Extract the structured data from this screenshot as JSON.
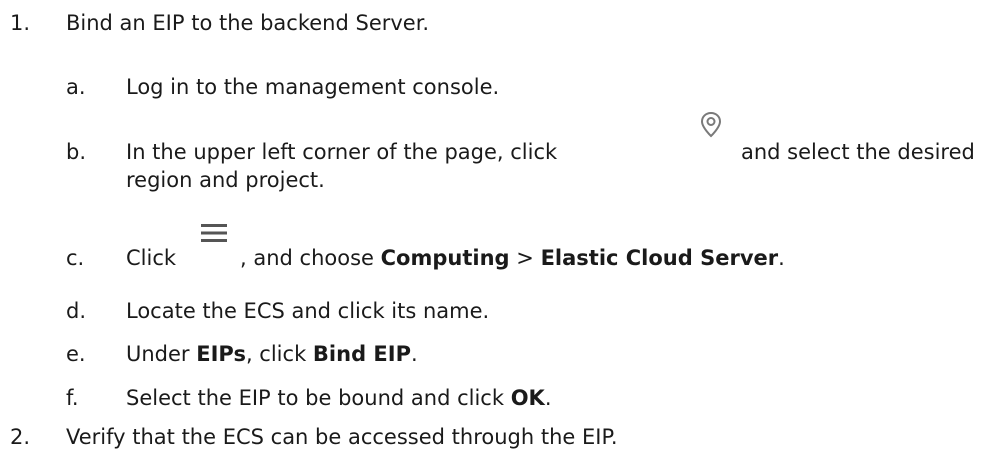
{
  "steps": [
    {
      "number": "1.",
      "text": "Bind an EIP to the backend Server.",
      "substeps": [
        {
          "letter": "a.",
          "text": "Log in to the management console."
        },
        {
          "letter": "b.",
          "text_before": "In the upper left corner of the page, click",
          "icon": "location-pin-icon",
          "text_after": "and select the desired",
          "text_line2": "region and project."
        },
        {
          "letter": "c.",
          "text_before": "Click",
          "icon": "menu-icon",
          "text_mid": ", and choose",
          "bold1": "Computing",
          "sep": ">",
          "bold2": "Elastic Cloud Server",
          "end": "."
        },
        {
          "letter": "d.",
          "text": "Locate the ECS and click its name."
        },
        {
          "letter": "e.",
          "text_before": "Under",
          "bold1": "EIPs",
          "text_mid": ", click",
          "bold2": "Bind EIP",
          "end": "."
        },
        {
          "letter": "f.",
          "text_before": "Select the EIP to be bound and click",
          "bold1": "OK",
          "end": "."
        }
      ]
    },
    {
      "number": "2.",
      "text": "Verify that the ECS can be accessed through the EIP."
    }
  ],
  "colors": {
    "text": "#1a1a1a",
    "icon": "#7a7a7a"
  }
}
